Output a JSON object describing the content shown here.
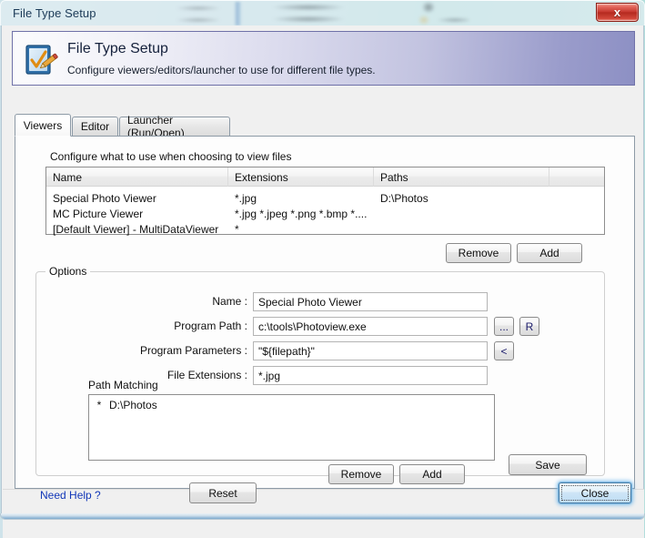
{
  "window": {
    "title": "File Type Setup",
    "close_icon": "x",
    "close_tooltip": "Close"
  },
  "banner": {
    "icon": "file-type-setup-icon",
    "title": "File Type Setup",
    "subtitle": "Configure viewers/editors/launcher to use for different file types."
  },
  "tabs": [
    {
      "label": "Viewers",
      "active": true
    },
    {
      "label": "Editor",
      "active": false
    },
    {
      "label": "Launcher (Run/Open)",
      "active": false
    }
  ],
  "panel": {
    "intro": "Configure what to use when choosing to view files"
  },
  "table": {
    "columns": [
      "Name",
      "Extensions",
      "Paths",
      ""
    ],
    "rows": [
      {
        "name": "Special Photo Viewer",
        "extensions": "*.jpg",
        "paths": "D:\\Photos"
      },
      {
        "name": "MC Picture Viewer",
        "extensions": "*.jpg *.jpeg *.png *.bmp *....",
        "paths": ""
      },
      {
        "name": "[Default Viewer] - MultiDataViewer",
        "extensions": "*",
        "paths": ""
      }
    ]
  },
  "table_actions": {
    "remove_label": "Remove",
    "add_label": "Add"
  },
  "options": {
    "legend": "Options",
    "fields": [
      {
        "label": "Name :",
        "value": "Special Photo Viewer"
      },
      {
        "label": "Program Path :",
        "value": "c:\\tools\\Photoview.exe"
      },
      {
        "label": "Program Parameters :",
        "value": "\"${filepath}\""
      },
      {
        "label": "File Extensions :",
        "value": "*.jpg"
      }
    ],
    "browse_button": "...",
    "registry_button": "R",
    "insert_button": "<",
    "path_matching_label": "Path Matching",
    "path_matching_rows": [
      {
        "star": "*",
        "path": "D:\\Photos"
      }
    ],
    "pm_remove_label": "Remove",
    "pm_add_label": "Add",
    "save_label": "Save"
  },
  "footer": {
    "help_link": "Need Help ?",
    "reset_label": "Reset",
    "close_label": "Close"
  },
  "colors": {
    "banner_accent": "#8d90c4",
    "link": "#1237b8",
    "close_button_red": "#c5352c",
    "focus_blue": "#66b4eb"
  }
}
